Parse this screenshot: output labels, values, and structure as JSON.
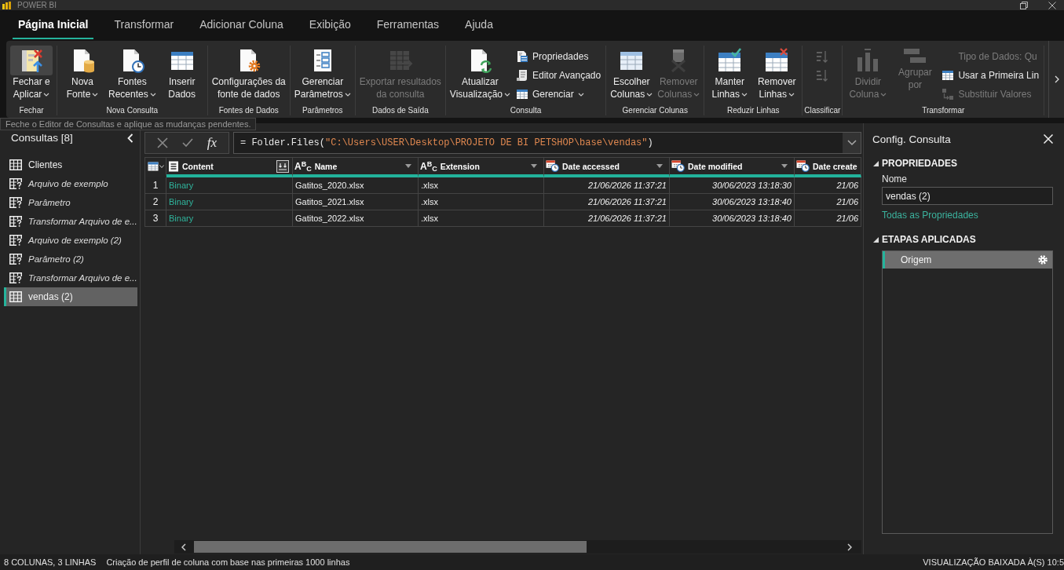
{
  "window": {
    "title": "POWER BI"
  },
  "tabs": [
    {
      "label": "Página Inicial",
      "selected": true
    },
    {
      "label": "Transformar",
      "selected": false
    },
    {
      "label": "Adicionar Coluna",
      "selected": false
    },
    {
      "label": "Exibição",
      "selected": false
    },
    {
      "label": "Ferramentas",
      "selected": false
    },
    {
      "label": "Ajuda",
      "selected": false
    }
  ],
  "ribbon": {
    "groups": [
      {
        "label": "Fechar",
        "items": [
          {
            "kind": "large",
            "lines": [
              "Fechar e",
              "Aplicar"
            ],
            "dropdown": true,
            "disabled": false,
            "hovered": true
          }
        ]
      },
      {
        "label": "Nova Consulta",
        "items": [
          {
            "kind": "large",
            "lines": [
              "Nova",
              "Fonte"
            ],
            "dropdown": true,
            "disabled": false,
            "hovered": false
          },
          {
            "kind": "large",
            "lines": [
              "Fontes",
              "Recentes"
            ],
            "dropdown": true,
            "disabled": false,
            "hovered": false
          },
          {
            "kind": "large",
            "lines": [
              "Inserir",
              "Dados"
            ],
            "dropdown": false,
            "disabled": false,
            "hovered": false
          }
        ]
      },
      {
        "label": "Fontes de Dados",
        "items": [
          {
            "kind": "large",
            "lines": [
              "Configurações da",
              "fonte de dados"
            ],
            "dropdown": false,
            "disabled": false,
            "hovered": false
          }
        ]
      },
      {
        "label": "Parâmetros",
        "items": [
          {
            "kind": "large",
            "lines": [
              "Gerenciar",
              "Parâmetros"
            ],
            "dropdown": true,
            "disabled": false,
            "hovered": false
          }
        ]
      },
      {
        "label": "Dados de Saída",
        "items": [
          {
            "kind": "large",
            "lines": [
              "Exportar resultados",
              "da consulta"
            ],
            "dropdown": false,
            "disabled": true,
            "hovered": false
          }
        ]
      },
      {
        "label": "Consulta",
        "items": [
          {
            "kind": "large",
            "lines": [
              "Atualizar",
              "Visualização"
            ],
            "dropdown": true,
            "disabled": false,
            "hovered": false
          },
          {
            "kind": "small",
            "lines": [
              "Propriedades"
            ],
            "dropdown": false,
            "disabled": false,
            "hovered": false
          },
          {
            "kind": "small",
            "lines": [
              "Editor Avançado"
            ],
            "dropdown": false,
            "disabled": false,
            "hovered": false
          },
          {
            "kind": "small",
            "lines": [
              "Gerenciar"
            ],
            "dropdown": true,
            "disabled": false,
            "hovered": false
          }
        ]
      },
      {
        "label": "Gerenciar Colunas",
        "items": [
          {
            "kind": "large",
            "lines": [
              "Escolher",
              "Colunas"
            ],
            "dropdown": true,
            "disabled": false,
            "hovered": false
          },
          {
            "kind": "large",
            "lines": [
              "Remover",
              "Colunas"
            ],
            "dropdown": true,
            "disabled": true,
            "hovered": false
          }
        ]
      },
      {
        "label": "Reduzir Linhas",
        "items": [
          {
            "kind": "large",
            "lines": [
              "Manter",
              "Linhas"
            ],
            "dropdown": true,
            "disabled": false,
            "hovered": false
          },
          {
            "kind": "large",
            "lines": [
              "Remover",
              "Linhas"
            ],
            "dropdown": true,
            "disabled": false,
            "hovered": false
          }
        ]
      },
      {
        "label": "Classificar",
        "items": [
          {
            "kind": "icon",
            "disabled": true,
            "hovered": false
          },
          {
            "kind": "icon",
            "disabled": true,
            "hovered": false
          }
        ]
      },
      {
        "label": "Transformar",
        "items": [
          {
            "kind": "large",
            "lines": [
              "Dividir",
              "Coluna"
            ],
            "dropdown": true,
            "disabled": true,
            "hovered": false
          },
          {
            "kind": "large",
            "lines": [
              "Agrupar",
              "por"
            ],
            "dropdown": false,
            "disabled": true,
            "hovered": false
          },
          {
            "kind": "small",
            "lines": [
              "Tipo de Dados: Qu"
            ],
            "dropdown": false,
            "disabled": true,
            "hovered": false
          },
          {
            "kind": "small",
            "lines": [
              "Usar a Primeira Lin"
            ],
            "dropdown": false,
            "disabled": false,
            "hovered": false
          },
          {
            "kind": "small",
            "lines": [
              "Substituir Valores"
            ],
            "dropdown": false,
            "disabled": true,
            "hovered": false
          }
        ]
      }
    ],
    "tooltip": "Feche o Editor de Consultas e aplique as mudanças pendentes."
  },
  "queries": {
    "title": "Consultas [8]",
    "items": [
      {
        "label": "Clientes",
        "kind": "table",
        "selected": false
      },
      {
        "label": "Arquivo de exemplo",
        "kind": "helper",
        "selected": false
      },
      {
        "label": "Parâmetro",
        "kind": "helper",
        "selected": false
      },
      {
        "label": "Transformar Arquivo de e...",
        "kind": "helper",
        "selected": false
      },
      {
        "label": "Arquivo de exemplo (2)",
        "kind": "helper",
        "selected": false
      },
      {
        "label": "Parâmetro (2)",
        "kind": "helper",
        "selected": false
      },
      {
        "label": "Transformar Arquivo de e...",
        "kind": "helper",
        "selected": false
      },
      {
        "label": "vendas (2)",
        "kind": "table",
        "selected": true
      }
    ]
  },
  "formula_bar": {
    "fx": "fx",
    "formula": [
      {
        "kind": "code",
        "text": "= Folder.Files("
      },
      {
        "kind": "string",
        "text": "\"C:\\Users\\USER\\Desktop\\PROJETO DE BI PETSHOP\\base\\vendas\""
      },
      {
        "kind": "code",
        "text": ")"
      }
    ]
  },
  "table": {
    "columns": [
      {
        "label": "Content",
        "kind": "binary",
        "expand_button": true,
        "filter_button": false
      },
      {
        "label": "Name",
        "kind": "text",
        "type_glyph": "A$^{B}$$_{C}$",
        "expand_button": false,
        "filter_button": true
      },
      {
        "label": "Extension",
        "kind": "text",
        "type_glyph": "A$^{B}$$_{C}$",
        "expand_button": false,
        "filter_button": true
      },
      {
        "label": "Date accessed",
        "kind": "datetime",
        "expand_button": false,
        "filter_button": true
      },
      {
        "label": "Date modified",
        "kind": "datetime",
        "expand_button": false,
        "filter_button": true
      },
      {
        "label": "Date create",
        "kind": "datetime",
        "expand_button": false,
        "filter_button": false
      }
    ],
    "rows": [
      {
        "number": "1",
        "cells": [
          "Binary",
          "Gatitos_2020.xlsx",
          ".xlsx",
          "21/06/2026 11:37:21",
          "30/06/2023 13:18:30",
          "21/06"
        ]
      },
      {
        "number": "2",
        "cells": [
          "Binary",
          "Gatitos_2021.xlsx",
          ".xlsx",
          "21/06/2026 11:37:21",
          "30/06/2023 13:18:40",
          "21/06"
        ]
      },
      {
        "number": "3",
        "cells": [
          "Binary",
          "Gatitos_2022.xlsx",
          ".xlsx",
          "21/06/2026 11:37:21",
          "30/06/2023 13:18:40",
          "21/06"
        ]
      }
    ]
  },
  "query_settings": {
    "title": "Config. Consulta",
    "properties": {
      "heading": "PROPRIEDADES",
      "expanded": true,
      "name_label": "Nome",
      "name_value": "vendas (2)",
      "link": "Todas as Propriedades"
    },
    "applied_steps": {
      "heading": "ETAPAS APLICADAS",
      "expanded": true,
      "steps": [
        {
          "label": "Origem",
          "selected": true,
          "settings": true
        }
      ]
    }
  },
  "status_bar": {
    "columns_rows": "8 COLUNAS, 3 LINHAS",
    "profiling": "Criação de perfil de coluna com base nas primeiras 1000 linhas",
    "preview": "VISUALIZAÇÃO BAIXADA À(S) 10:5"
  }
}
